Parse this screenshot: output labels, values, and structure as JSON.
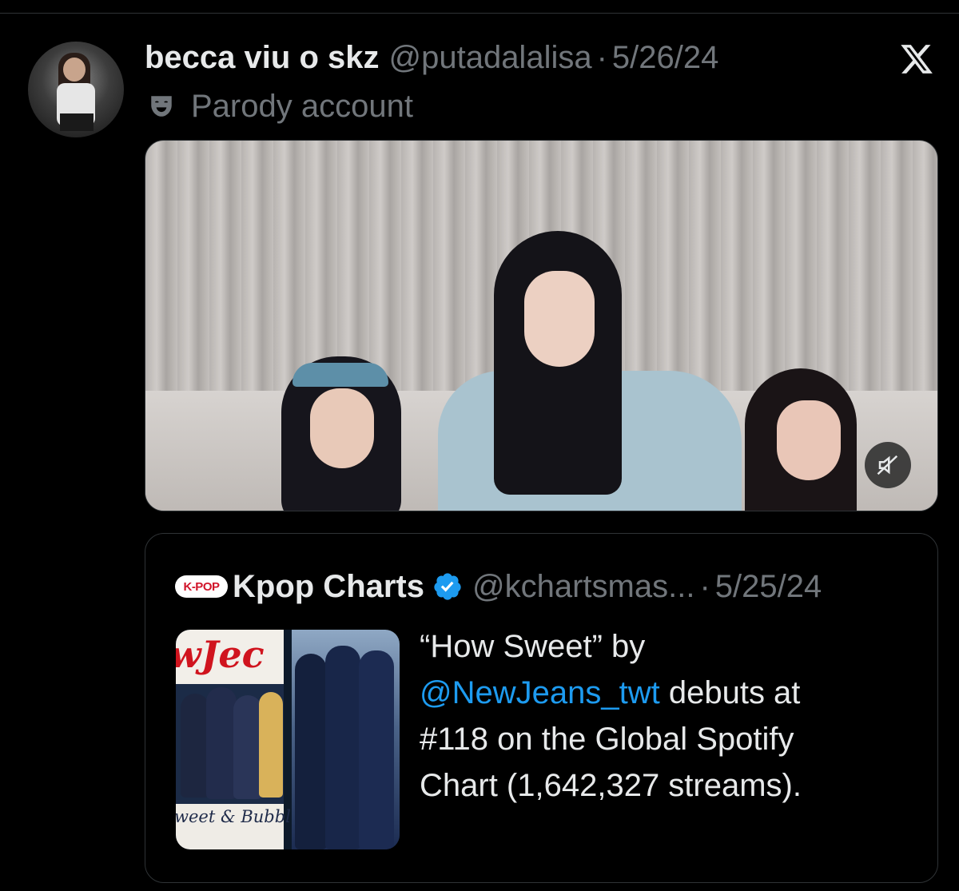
{
  "tweet": {
    "display_name": "becca viu o skz",
    "handle": "@putadalalisa",
    "separator": "·",
    "date": "5/26/24",
    "parody_label": "Parody account",
    "icons": {
      "parody": "theater-mask-icon",
      "platform": "x-logo-icon",
      "mute": "speaker-muted-icon"
    }
  },
  "quote": {
    "logo_text": "K-POP",
    "display_name": "Kpop Charts",
    "verified": true,
    "handle": "@kchartsmas...",
    "separator": "·",
    "date": "5/25/24",
    "text_before": "“How Sweet” by ",
    "mention": "@NewJeans_twt",
    "text_after": " debuts at #118 on the Global Spotify Chart (1,642,327 streams).",
    "thumbnail": {
      "cover_title": "wJec",
      "cover_subtitle": "weet & Bubbl"
    }
  },
  "colors": {
    "background": "#000000",
    "primary_text": "#e7e9ea",
    "secondary_text": "#71767b",
    "link": "#1d9bf0",
    "verified": "#1d9bf0",
    "border": "#2f3336"
  }
}
